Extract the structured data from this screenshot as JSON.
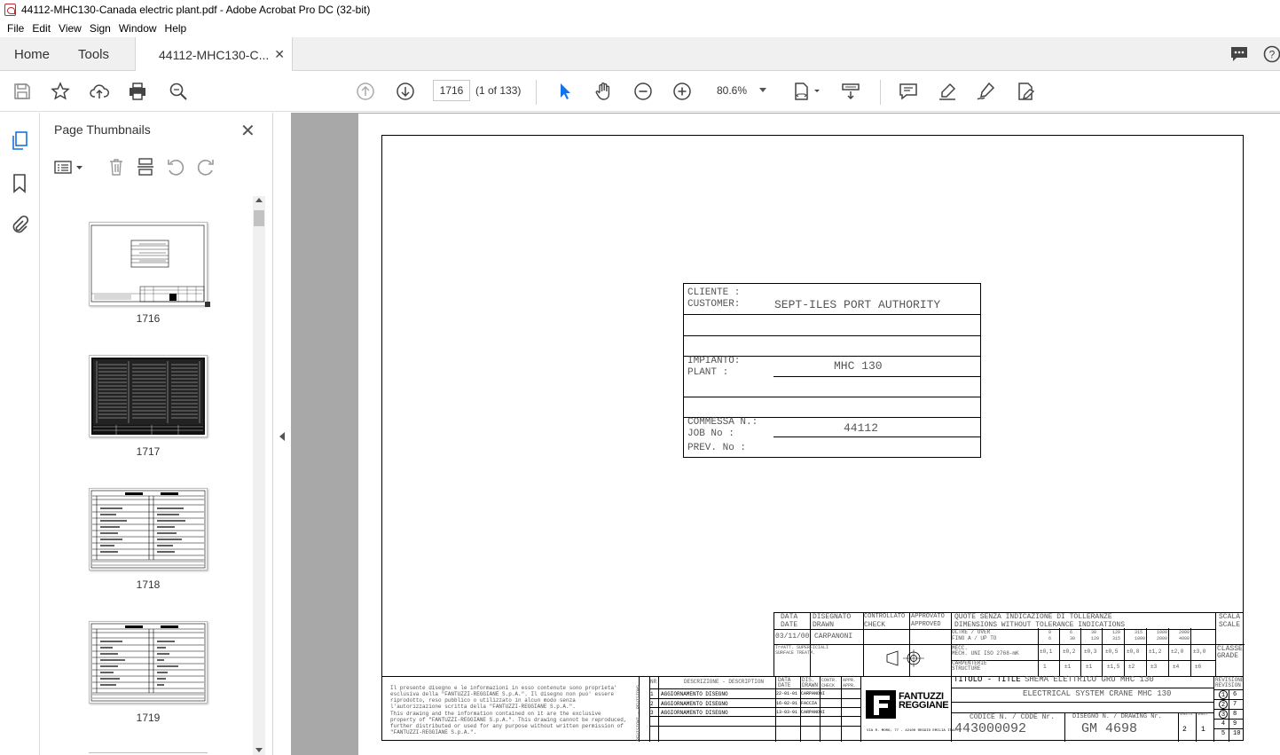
{
  "window": {
    "title": "44112-MHC130-Canada electric plant.pdf - Adobe Acrobat Pro DC (32-bit)"
  },
  "menu": [
    "File",
    "Edit",
    "View",
    "Sign",
    "Window",
    "Help"
  ],
  "tabs": {
    "home": "Home",
    "tools": "Tools",
    "document": "44112-MHC130-C..."
  },
  "toolbar": {
    "page_number": "1716",
    "page_of": "(1 of 133)",
    "zoom": "80.6%"
  },
  "thumbnails": {
    "title": "Page Thumbnails",
    "pages": [
      "1716",
      "1717",
      "1718",
      "1719"
    ]
  },
  "drawing": {
    "customer_label_1": "CLIENTE  :",
    "customer_label_2": "CUSTOMER:",
    "customer_value": "SEPT-ILES PORT AUTHORITY",
    "plant_label_1": "IMPIANTO:",
    "plant_label_2": "PLANT    :",
    "plant_value": "MHC 130",
    "job_label_1": "COMMESSA N.:",
    "job_label_2": "JOB No      :",
    "job_value": "44112",
    "prev_label": "PREV. No    :",
    "tb_date_h1": "DATA",
    "tb_date_h2": "DATE",
    "tb_drawn_h1": "DISEGNATO",
    "tb_drawn_h2": "DRAWN",
    "tb_check_h1": "CONTROLLATO",
    "tb_check_h2": "CHECK",
    "tb_appr_h1": "APPROVATO",
    "tb_appr_h2": "APPROVED",
    "tb_date_value": "03/11/00",
    "tb_drawn_value": "CARPANONI",
    "tb_ref": "Tr#ATT. SUPERFICIALI SURFACE TREATM.",
    "tol_title_1": "QUOTE SENZA INDICAZIONE DI TOLLERANZE",
    "tol_title_2": "DIMENSIONS WITHOUT TOLERANCE INDICATIONS",
    "tol_over": "OLTRE / OVER",
    "tol_upto": "FINO A / UP TO",
    "tol_mech": "MECC.",
    "tol_mech2": "MECH. UNI ISO 2768-mK",
    "tol_struct": "CARPENTERIE",
    "tol_struct2": "STRUCTURE",
    "tol_cols": [
      "6",
      "30",
      "120",
      "315",
      "1000",
      "2000",
      "4000"
    ],
    "tol_cols_top": [
      "0",
      "6",
      "30",
      "120",
      "315",
      "1000",
      "2000"
    ],
    "tol_mech_vals": [
      "±0,1",
      "±0,2",
      "±0,3",
      "±0,5",
      "±0,8",
      "±1,2",
      "±2,0",
      "±3,0"
    ],
    "tol_struct_vals": [
      "1",
      "±1",
      "±1",
      "±1,5",
      "±2",
      "±3",
      "±4",
      "±6"
    ],
    "scale_1": "SCALA",
    "scale_2": "SCALE",
    "class_1": "CLASSE",
    "class_2": "GRADE",
    "titolo": "TITOLO - TITLE",
    "titolo_value_1": "SHEMA ELETTRICO GRU MHC 130",
    "titolo_value_2": "ELECTRICAL SYSTEM CRANE MHC 130",
    "code_label": "CODICE N. / CODE Nr.",
    "code_value": "443000092",
    "drawing_label": "DISEGNO N. / DRAWING Nr.",
    "drawing_value": "GM 4698",
    "sheets_label": "SHEETS",
    "sheet_label": "SHEET",
    "sheets_value": "2",
    "sheet_value": "1",
    "rev_label_1": "REVISIONE",
    "rev_label_2": "REVISION",
    "rev_nums": [
      "1",
      "6",
      "2",
      "7",
      "3",
      "8",
      "4",
      "9",
      "5",
      "10"
    ],
    "company_1": "FANTUZZI",
    "company_2": "REGGIANE",
    "company_addr": "VIA R. MORO, 77 - 42100 REGGIO EMILIA ITALY",
    "desc_header": "DESCRIZIONE - DESCRIPTION",
    "date_h": "DATA DATE",
    "drawn_h": "DIS. DRAWN",
    "check_h": "CONTR. CHECK",
    "appr_h": "APPR. APPR.",
    "nr_h": "NR.",
    "revisioni_vertical": "REVISIONI - REVISIONS",
    "rev_rows": [
      {
        "nr": "1",
        "desc": "AGGIORNAMENTO DISEGNO",
        "date": "22-01-01",
        "drawn": "CARPANONI"
      },
      {
        "nr": "2",
        "desc": "AGGIORNAMENTO DISEGNO",
        "date": "16-02-01",
        "drawn": "FACCIA"
      },
      {
        "nr": "3",
        "desc": "AGGIORNAMENTO DISEGNO",
        "date": "13-03-01",
        "drawn": "CARPANONI"
      }
    ],
    "legal_it": "Il presente disegno e le informazioni in esso contenute sono proprieta' esclusiva della \"FANTUZZI-REGGIANE S.p.A.\". Il disegno non puo' essere riprodotto, reso pubblico o utilizzato in alcun modo senza l'autorizzazione scritta della \"FANTUZZI-REGGIANE S.p.A.\".",
    "legal_en": "This drawing and the information contained on it are the exclusive property of \"FANTUZZI-REGGIANE S.p.A.\". This drawing cannot be reproduced, further distributed or used for any purpose without written permission of \"FANTUZZI-REGGIANE S.p.A.\"."
  }
}
